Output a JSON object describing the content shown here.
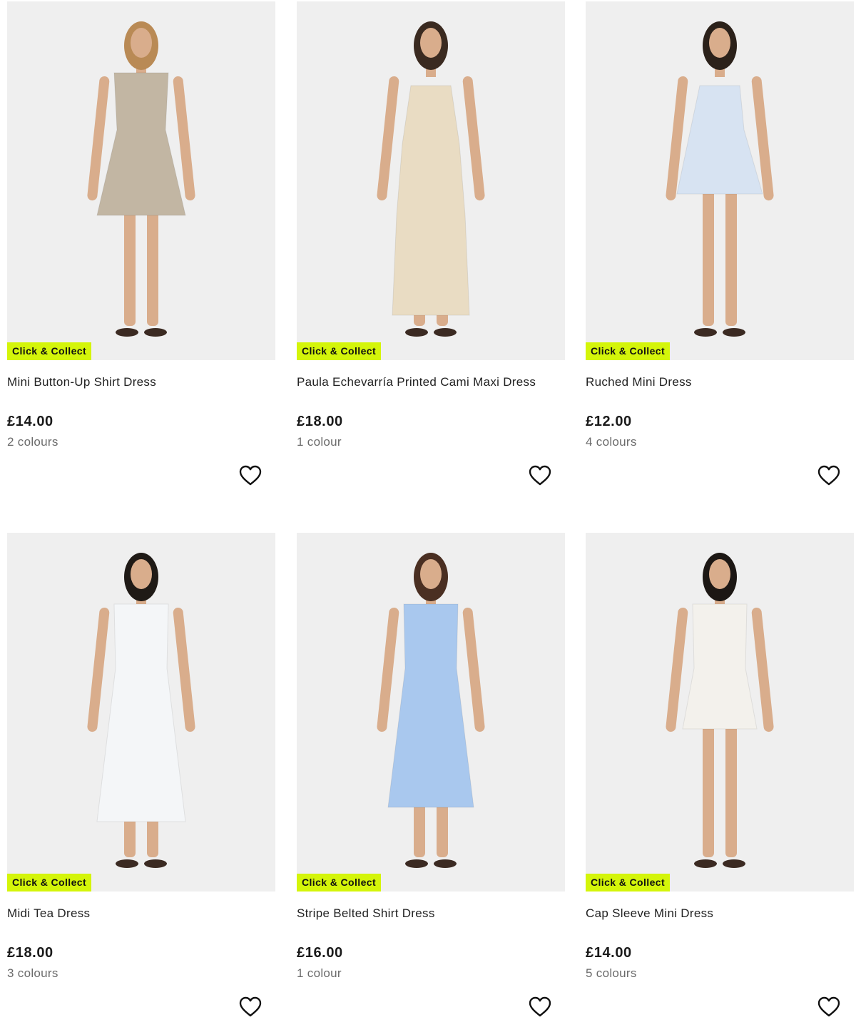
{
  "products": [
    {
      "name": "Mini Button-Up Shirt Dress",
      "price": "£14.00",
      "colours": "2 colours",
      "badge": "Click & Collect",
      "dress_color": "#c2b6a3",
      "dress_style": "shirt-mini",
      "hair_color": "#b98a55"
    },
    {
      "name": "Paula Echevarría Printed Cami Maxi Dress",
      "price": "£18.00",
      "colours": "1 colour",
      "badge": "Click & Collect",
      "dress_color": "#e9dcc3",
      "dress_style": "cami-maxi",
      "hair_color": "#3a2a20"
    },
    {
      "name": "Ruched Mini Dress",
      "price": "£12.00",
      "colours": "4 colours",
      "badge": "Click & Collect",
      "dress_color": "#d7e3f2",
      "dress_style": "cami-mini",
      "hair_color": "#2b211a"
    },
    {
      "name": "Midi Tea Dress",
      "price": "£18.00",
      "colours": "3 colours",
      "badge": "Click & Collect",
      "dress_color": "#f4f6f8",
      "dress_style": "tea-midi",
      "hair_color": "#1f1a16"
    },
    {
      "name": "Stripe Belted Shirt Dress",
      "price": "£16.00",
      "colours": "1 colour",
      "badge": "Click & Collect",
      "dress_color": "#a9c8ee",
      "dress_style": "shirt-midi",
      "hair_color": "#4a2f22"
    },
    {
      "name": "Cap Sleeve Mini Dress",
      "price": "£14.00",
      "colours": "5 colours",
      "badge": "Click & Collect",
      "dress_color": "#f3f1ec",
      "dress_style": "cap-mini",
      "hair_color": "#1c1714"
    }
  ],
  "icons": {
    "wishlist": "heart-outline-icon"
  },
  "colors": {
    "badge_bg": "#d4f50a",
    "photo_bg": "#efefef"
  }
}
